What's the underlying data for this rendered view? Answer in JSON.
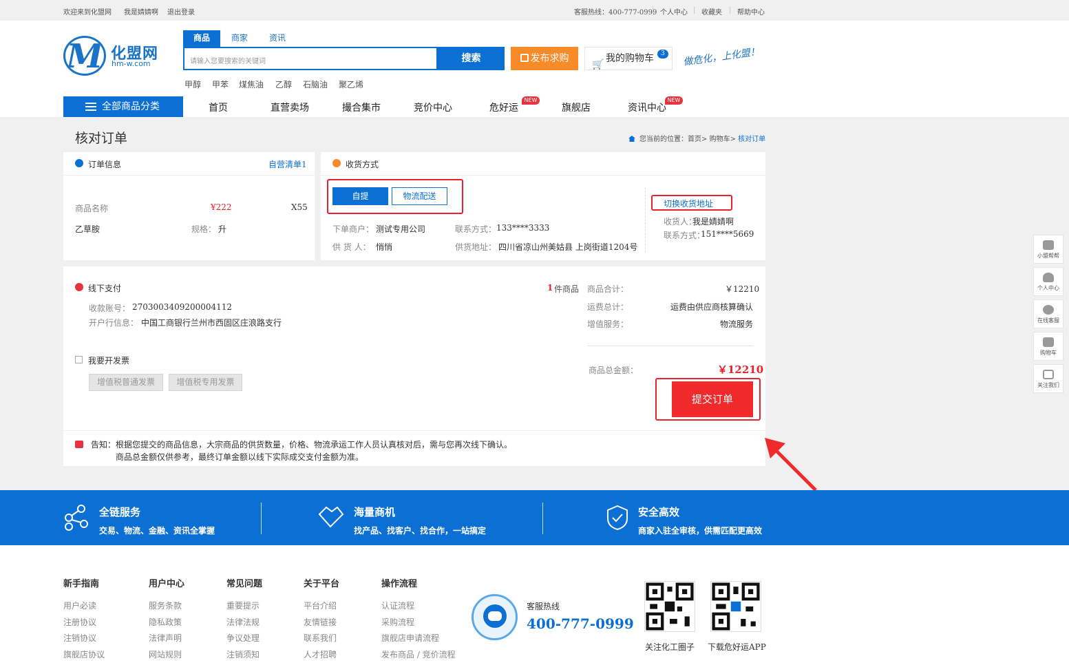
{
  "topbar": {
    "welcome": "欢迎来到化盟网",
    "username": "我是婧婧啊",
    "logout": "退出登录",
    "hotline": "客服热线：400-777-0999",
    "personal": "个人中心",
    "favorites": "收藏夹",
    "help": "帮助中心"
  },
  "logo": {
    "name": "化盟网",
    "domain": "hm-w.com"
  },
  "search": {
    "tabs": [
      "商品",
      "商家",
      "资讯"
    ],
    "placeholder": "请输入您要搜索的关键词",
    "button": "搜索",
    "hotwords": [
      "甲醇",
      "甲苯",
      "煤焦油",
      "乙醇",
      "石脑油",
      "聚乙烯"
    ]
  },
  "header": {
    "publish": "发布求购",
    "cart": "我的购物车",
    "cart_count": "3",
    "slogan": "做危化，上化盟！"
  },
  "nav": {
    "all_categories": "全部商品分类",
    "items": [
      "首页",
      "直营卖场",
      "撮合集市",
      "竞价中心",
      "危好运",
      "旗舰店",
      "资讯中心"
    ],
    "new_tag": "NEW"
  },
  "page": {
    "title": "核对订单",
    "breadcrumb_prefix": "您当前的位置：",
    "breadcrumb": [
      "首页",
      "购物车",
      "核对订单"
    ],
    "bc_sep": ">"
  },
  "order_info": {
    "title": "订单信息",
    "list_link": "自营清单1",
    "name_label": "商品名称",
    "price": "¥222",
    "qty": "X55",
    "product": "乙草胺",
    "spec_label": "规格：",
    "spec": "升"
  },
  "delivery": {
    "title": "收货方式",
    "pickup": "自提",
    "logistics": "物流配送",
    "merchant_label": "下单商户：",
    "merchant": "测试专用公司",
    "contact_label": "联系方式：",
    "contact": "133****3333",
    "supplier_label": "供 货 人：",
    "supplier": "悄悄",
    "address_label": "供货地址：",
    "address": "四川省凉山州美姑县 上岗街道1204号",
    "switch_address": "切换收货地址",
    "receiver_label": "收货人：",
    "receiver": "我是婧婧啊",
    "receiver_contact_label": "联系方式：",
    "receiver_contact": "151****5669"
  },
  "payment": {
    "title": "线下支付",
    "account_label": "收款账号：",
    "account": "2703003409200004112",
    "bank_label": "开户行信息：",
    "bank": "中国工商银行兰州市西固区庄浪路支行",
    "invoice_label": "我要开发票",
    "invoice_normal": "增值税普通发票",
    "invoice_special": "增值税专用发票"
  },
  "summary": {
    "count": "1",
    "count_unit": "件商品",
    "goods_total_label": "商品合计：",
    "goods_total": "￥12210",
    "freight_label": "运费总计：",
    "freight": "运费由供应商核算确认",
    "vas_label": "增值服务：",
    "vas": "物流服务",
    "grand_total_label": "商品总金额：",
    "grand_total": "￥12210",
    "submit": "提交订单"
  },
  "notice": {
    "label": "告知：",
    "line1": "根据您提交的商品信息，大宗商品的供货数量，价格、物流承运工作人员认真核对后，需与您再次线下确认。",
    "line2": "商品总金额仅供参考，最终订单金额以线下实际成交支付金额为准。"
  },
  "sidebar": [
    "小盟帮帮",
    "个人中心",
    "在线客服",
    "购物车",
    "关注我们"
  ],
  "band": [
    {
      "title": "全链服务",
      "sub": "交易、物流、金融、资讯全掌握"
    },
    {
      "title": "海量商机",
      "sub": "找产品、找客户、找合作，一站搞定"
    },
    {
      "title": "安全高效",
      "sub": "商家入驻全审核，供需匹配更高效"
    }
  ],
  "footer": {
    "cols": [
      {
        "head": "新手指南",
        "links": [
          "用户必读",
          "注册协议",
          "注销协议",
          "旗舰店协议"
        ]
      },
      {
        "head": "用户中心",
        "links": [
          "服务条款",
          "隐私政策",
          "法律声明",
          "网站规则"
        ]
      },
      {
        "head": "常见问题",
        "links": [
          "重要提示",
          "法律法规",
          "争议处理",
          "注销须知"
        ]
      },
      {
        "head": "关于平台",
        "links": [
          "平台介绍",
          "友情链接",
          "联系我们",
          "人才招聘"
        ]
      },
      {
        "head": "操作流程",
        "links": [
          "认证流程",
          "采购流程",
          "旗舰店申请流程",
          "发布商品 / 竞价流程"
        ]
      }
    ],
    "hotline_label": "客服热线",
    "hotline": "400-777-0999",
    "qr1": "关注化工圈子",
    "qr2": "下载危好运APP"
  },
  "colors": {
    "brand": "#0b6fd4",
    "accent_red": "#e8222c",
    "orange": "#f78b2a"
  }
}
